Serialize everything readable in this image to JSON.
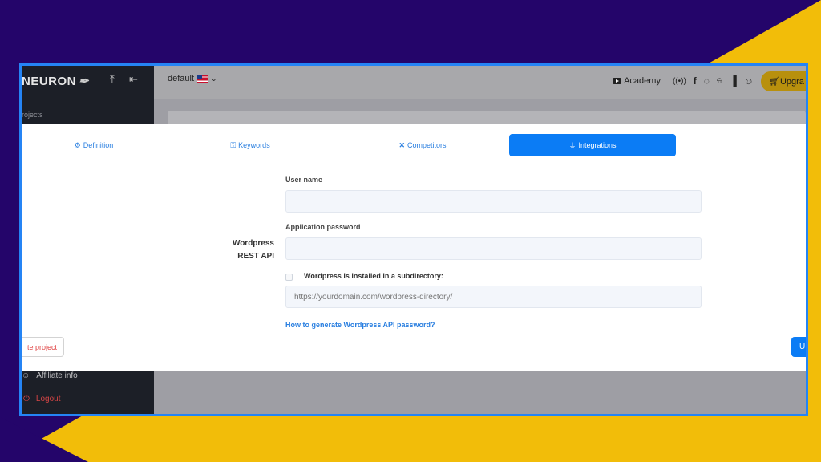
{
  "colors": {
    "background": "#24056a",
    "accent_yellow": "#f2bd09",
    "frame_border": "#2584f5",
    "primary": "#0b7cf5",
    "danger": "#e04545"
  },
  "sidebar": {
    "brand": "NEURON",
    "section_label": "rojects",
    "affiliate_label": "Affiliate info",
    "logout_label": "Logout"
  },
  "topbar": {
    "workspace_label": "default",
    "academy_label": "Academy",
    "upgrade_label": "Upgra",
    "icons": [
      "pin-icon",
      "collapse-icon",
      "youtube-icon",
      "broadcast-icon",
      "facebook-icon",
      "chat-icon",
      "bell-icon",
      "chart-icon",
      "user-icon",
      "cart-icon"
    ]
  },
  "tabs": [
    {
      "label": "Definition",
      "icon": "definition-icon"
    },
    {
      "label": "Keywords",
      "icon": "key-icon"
    },
    {
      "label": "Competitors",
      "icon": "x-icon"
    },
    {
      "label": "Integrations",
      "icon": "plug-icon"
    }
  ],
  "form": {
    "section_line1": "Wordpress",
    "section_line2": "REST API",
    "username_label": "User name",
    "username_value": "",
    "password_label": "Application password",
    "password_value": "",
    "subdirectory_label": "Wordpress is installed in a subdirectory:",
    "subdirectory_placeholder": "https://yourdomain.com/wordpress-directory/",
    "help_link": "How to generate Wordpress API password?"
  },
  "actions": {
    "delete_label": "te project",
    "update_label": "U"
  }
}
